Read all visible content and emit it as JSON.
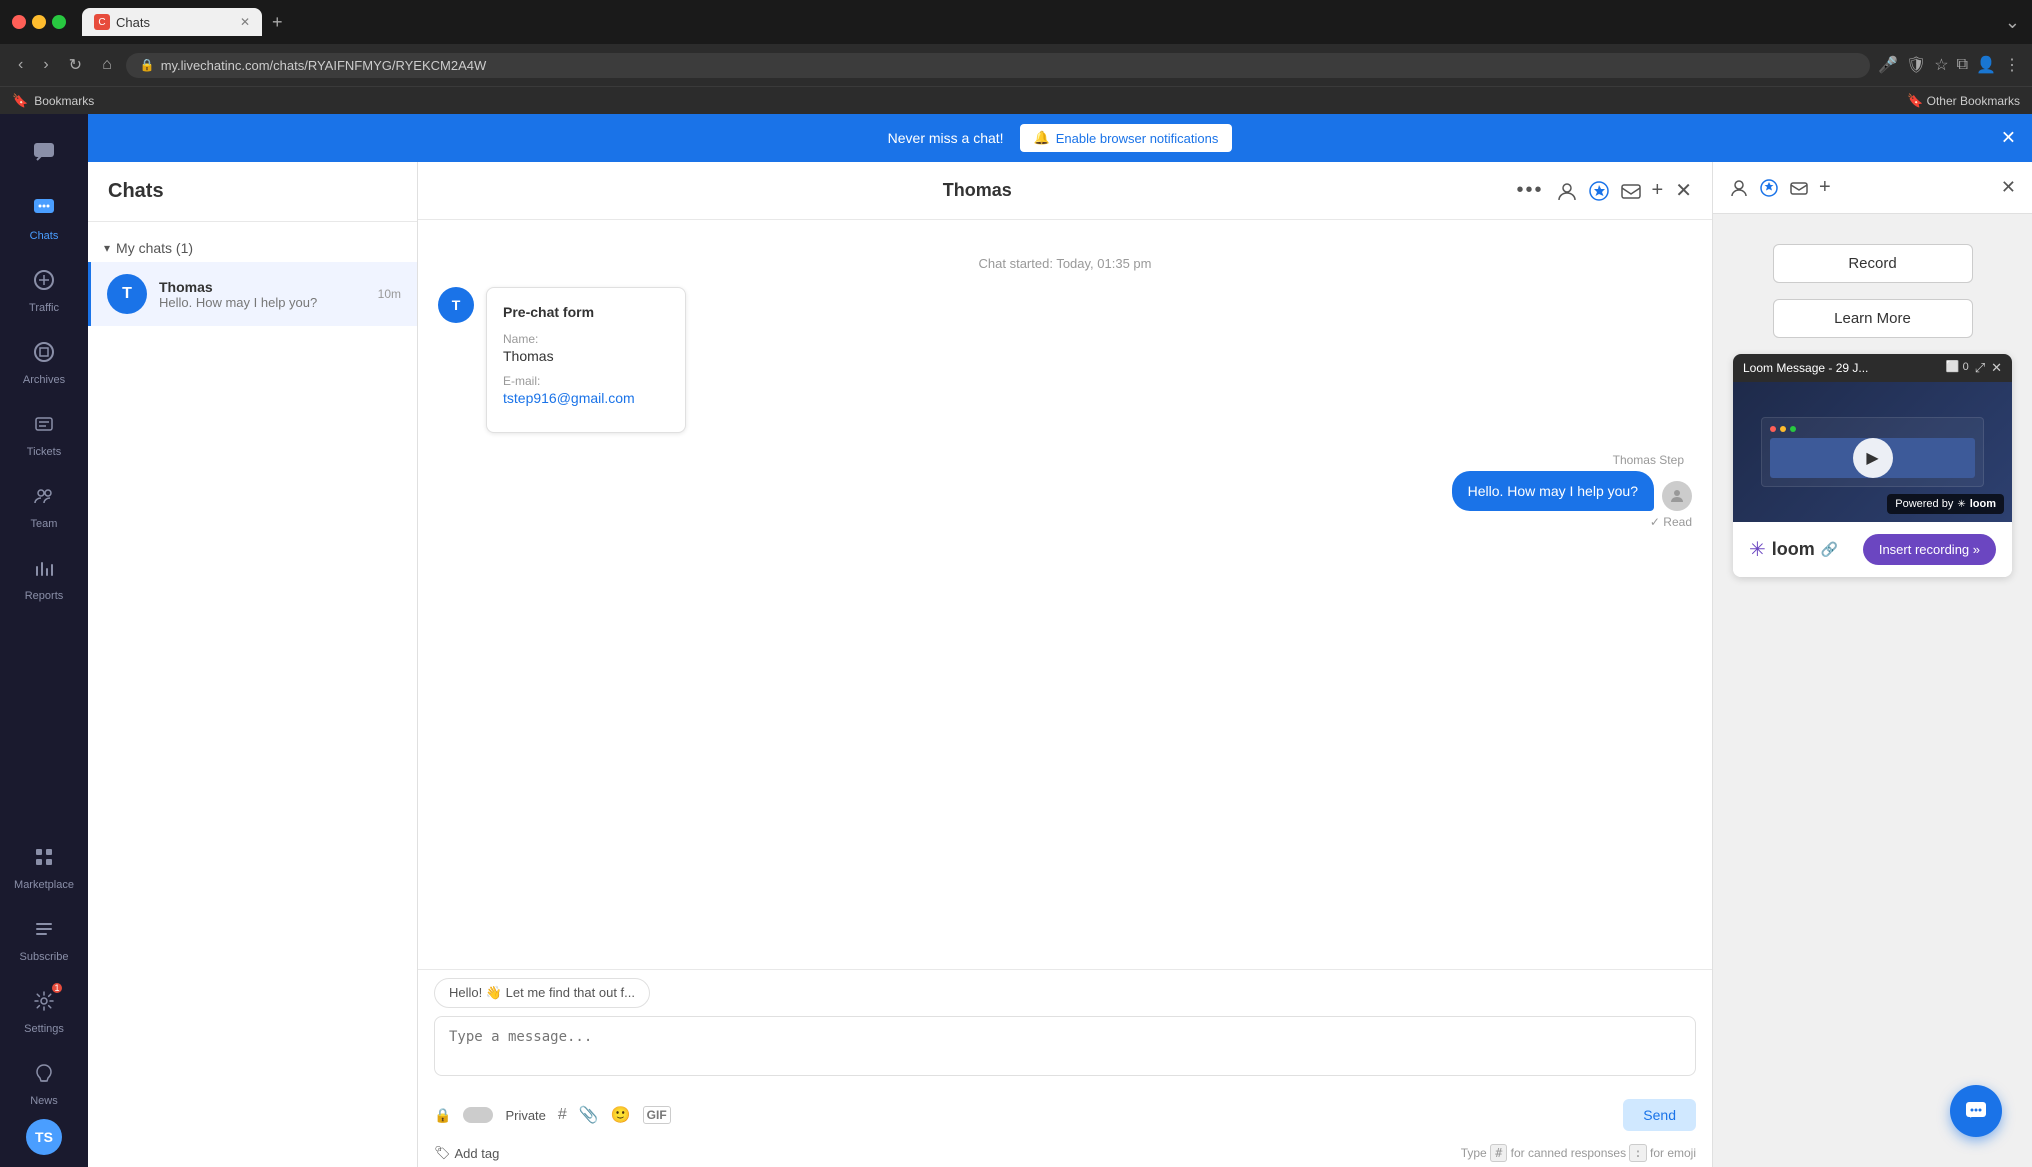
{
  "browser": {
    "tab_label": "Chats",
    "tab_icon": "C",
    "url": "my.livechatinc.com/chats/RYAIFNFMYG/RYEKCM2A4W",
    "bookmarks_label": "Bookmarks",
    "other_bookmarks_label": "Other Bookmarks",
    "more_icon": "⌄"
  },
  "notification_banner": {
    "text": "Never miss a chat!",
    "button_label": "Enable browser notifications",
    "bell_icon": "🔔",
    "close_icon": "✕"
  },
  "sidebar": {
    "chat_icon": "💬",
    "traffic_icon": "📊",
    "archives_icon": "🗄",
    "tickets_icon": "🎫",
    "team_icon": "👥",
    "reports_icon": "📈",
    "marketplace_icon": "⊞",
    "subscribe_icon": "≡",
    "settings_icon": "⚙",
    "news_icon": "🔔",
    "items": [
      {
        "label": "Chats",
        "id": "chats",
        "active": true
      },
      {
        "label": "Traffic",
        "id": "traffic",
        "active": false
      },
      {
        "label": "Archives",
        "id": "archives",
        "active": false
      },
      {
        "label": "Tickets",
        "id": "tickets",
        "active": false
      },
      {
        "label": "Team",
        "id": "team",
        "active": false
      },
      {
        "label": "Reports",
        "id": "reports",
        "active": false
      }
    ],
    "bottom_items": [
      {
        "label": "Marketplace",
        "id": "marketplace"
      },
      {
        "label": "Subscribe",
        "id": "subscribe"
      },
      {
        "label": "Settings",
        "id": "settings",
        "badge": "1"
      },
      {
        "label": "News",
        "id": "news"
      }
    ],
    "avatar_initials": "TS"
  },
  "chat_list": {
    "title": "Chats",
    "section_label": "My chats (1)",
    "chat_item": {
      "name": "Thomas",
      "preview": "Hello. How may I help you?",
      "time": "10m",
      "avatar_color": "#1a73e8",
      "avatar_initials": "T"
    }
  },
  "chat_main": {
    "title": "Thomas",
    "more_icon": "•••",
    "date_divider": "Chat started: Today, 01:35 pm",
    "pre_chat_form": {
      "title": "Pre-chat form",
      "name_label": "Name:",
      "name_value": "Thomas",
      "email_label": "E-mail:",
      "email_value": "tstep916@gmail.com"
    },
    "agent_message": {
      "agent_name": "Thomas Step",
      "text": "Hello. How may I help you?",
      "status": "✓ Read"
    },
    "quick_reply_label": "Hello! 👋 Let me find that out f...",
    "message_input_placeholder": "Type a message...",
    "private_label": "Private",
    "send_label": "Send",
    "add_tag_label": "Add tag",
    "keyboard_hint_1": "Type",
    "keyboard_hint_hash": "#",
    "keyboard_hint_canned": "for canned responses",
    "keyboard_hint_colon": ":",
    "keyboard_hint_emoji": "for emoji"
  },
  "loom_panel": {
    "record_label": "Record",
    "learn_more_label": "Learn More",
    "video_title": "Loom Message - 29 J...",
    "close_icon": "✕",
    "powered_by_label": "Powered by",
    "loom_label": "loom",
    "brand_name": "loom",
    "insert_recording_label": "Insert recording »"
  },
  "floating_btn": {
    "icon": "💬"
  }
}
